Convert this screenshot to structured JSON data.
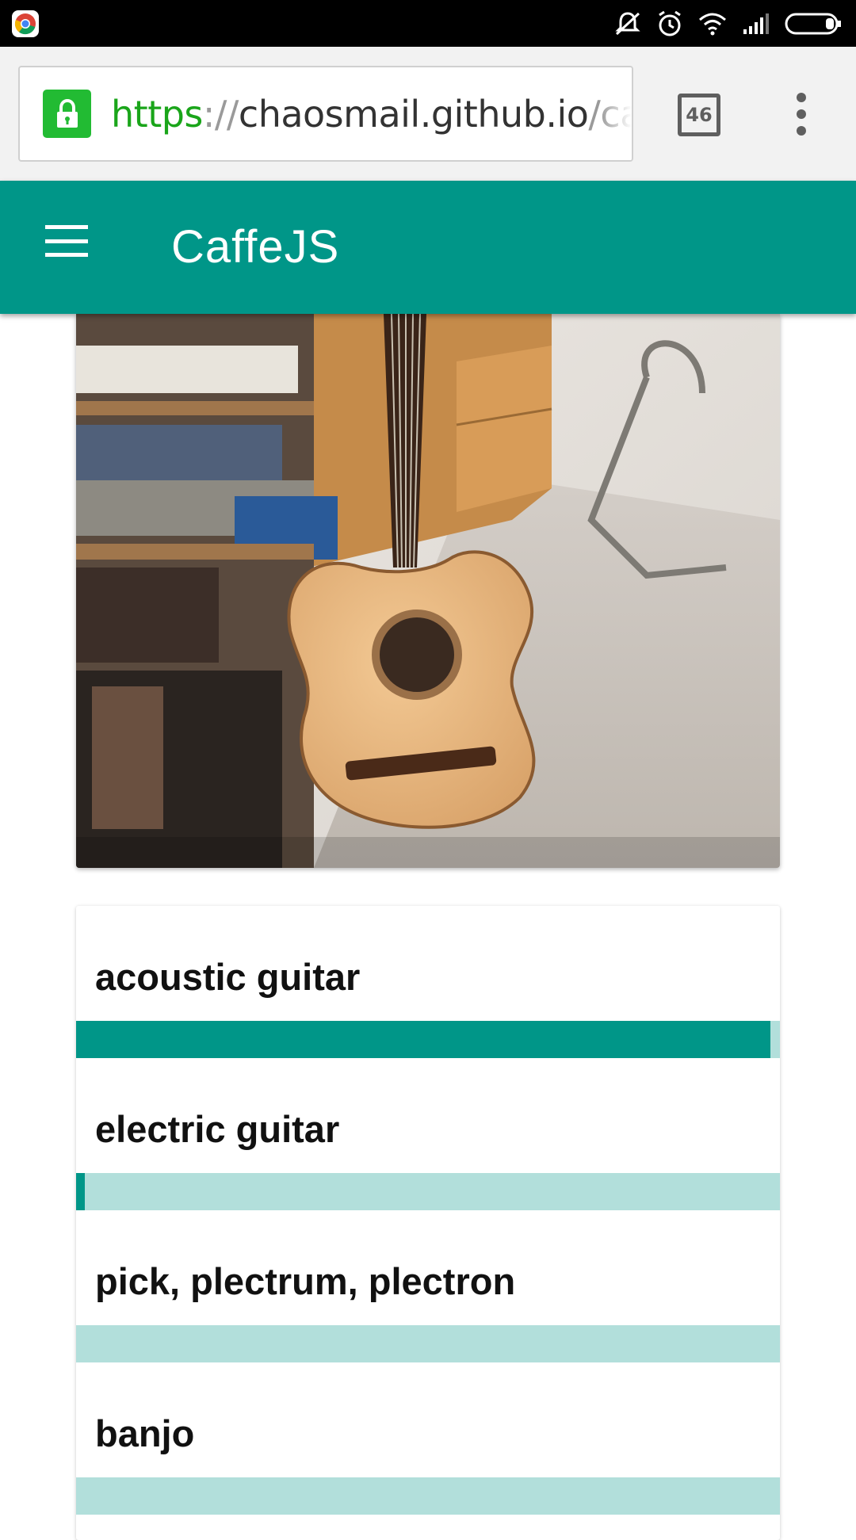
{
  "status_bar": {
    "app_icon": "chrome-icon",
    "icons": [
      "muted-vibrate-icon",
      "alarm-icon",
      "wifi-icon",
      "cell-signal-icon",
      "battery-icon"
    ]
  },
  "browser": {
    "url": {
      "scheme": "https",
      "separator": "://",
      "host": "chaosmail.github.io",
      "path": "/caffe"
    },
    "tab_count": "46",
    "lock_icon": "lock-icon",
    "menu_icon": "overflow-menu-icon"
  },
  "app_bar": {
    "title": "CaffeJS",
    "menu_icon": "hamburger-menu-icon"
  },
  "colors": {
    "primary": "#009688",
    "bar_track": "#b2dfdb",
    "secure_green": "#22bb33"
  },
  "results": [
    {
      "label": "acoustic guitar",
      "score": 0.986
    },
    {
      "label": "electric guitar",
      "score": 0.012
    },
    {
      "label": "pick, plectrum, plectron",
      "score": 0.0
    },
    {
      "label": "banjo",
      "score": 0.0
    }
  ]
}
